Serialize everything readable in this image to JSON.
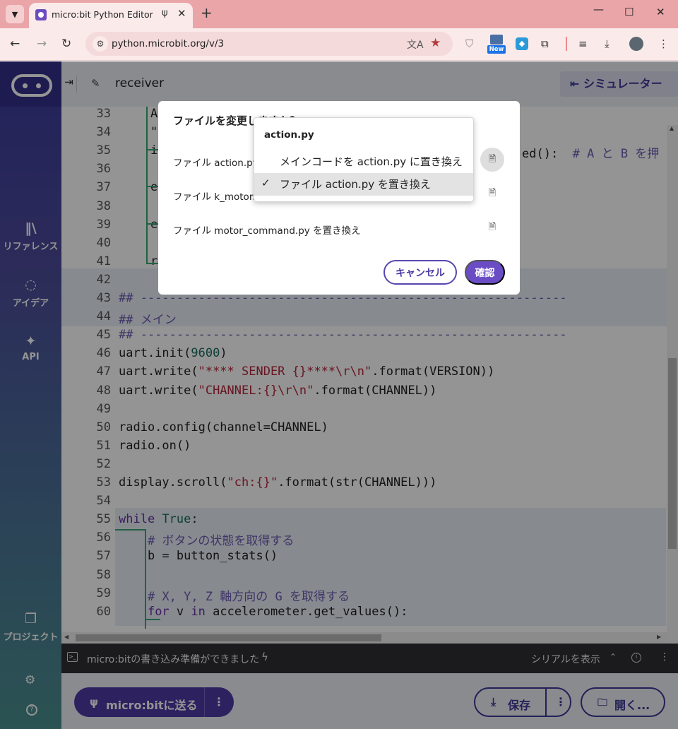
{
  "browser": {
    "tab_title": "micro:bit Python Editor",
    "tab_usb_icon": "usb-icon",
    "url": "python.microbit.org/v/3",
    "new_badge": "New"
  },
  "sidebar": {
    "reference": "リファレンス",
    "ideas": "アイデア",
    "api": "API",
    "project": "プロジェクト"
  },
  "header": {
    "project_name": "receiver",
    "simulator_label": "シミュレーター"
  },
  "editor": {
    "lines": [
      {
        "n": "33",
        "t": "A"
      },
      {
        "n": "34",
        "t": "\""
      },
      {
        "n": "35",
        "t": "i",
        "tail": "ed():  # A と B を押"
      },
      {
        "n": "36",
        "t": ""
      },
      {
        "n": "37",
        "t": "e"
      },
      {
        "n": "38",
        "t": ""
      },
      {
        "n": "39",
        "t": "e"
      },
      {
        "n": "40",
        "t": ""
      },
      {
        "n": "41",
        "t": "r"
      },
      {
        "n": "42",
        "t": ""
      },
      {
        "n": "43",
        "t": "## -----------------------------------------------------------"
      },
      {
        "n": "44",
        "t": "## メイン"
      },
      {
        "n": "45",
        "t": "## -----------------------------------------------------------"
      },
      {
        "n": "46",
        "t": "uart.init(9600)"
      },
      {
        "n": "47",
        "t": "uart.write(\"**** SENDER {}****\\r\\n\".format(VERSION))"
      },
      {
        "n": "48",
        "t": "uart.write(\"CHANNEL:{}\\r\\n\".format(CHANNEL))"
      },
      {
        "n": "49",
        "t": ""
      },
      {
        "n": "50",
        "t": "radio.config(channel=CHANNEL)"
      },
      {
        "n": "51",
        "t": "radio.on()"
      },
      {
        "n": "52",
        "t": ""
      },
      {
        "n": "53",
        "t": "display.scroll(\"ch:{}\".format(str(CHANNEL)))"
      },
      {
        "n": "54",
        "t": ""
      },
      {
        "n": "55",
        "t": "while True:"
      },
      {
        "n": "56",
        "t": "    # ボタンの状態を取得する"
      },
      {
        "n": "57",
        "t": "    b = button_stats()"
      },
      {
        "n": "58",
        "t": ""
      },
      {
        "n": "59",
        "t": "    # X, Y, Z 軸方向の G を取得する"
      },
      {
        "n": "60",
        "t": "    for v in accelerometer.get_values():"
      }
    ]
  },
  "status": {
    "message": "micro:bitの書き込み準備ができました",
    "serial": "シリアルを表示"
  },
  "bottom": {
    "send": "micro:bitに送る",
    "save": "保存",
    "open": "開く..."
  },
  "dialog": {
    "title": "ファイルを変更しますか？",
    "options": [
      "ファイル action.py を置き換え",
      "ファイル k_motor.py を置き換え",
      "ファイル motor_command.py を置き換え"
    ],
    "cancel": "キャンセル",
    "confirm": "確認"
  },
  "popup": {
    "header": "action.py",
    "items": [
      {
        "label": "メインコードを action.py に置き換え",
        "checked": false
      },
      {
        "label": "ファイル action.py を置き換え",
        "checked": true
      }
    ]
  },
  "colors": {
    "accent": "#4e3aa6",
    "tabstrip": "#e9a5a8",
    "status_bg": "#2f2f34"
  }
}
